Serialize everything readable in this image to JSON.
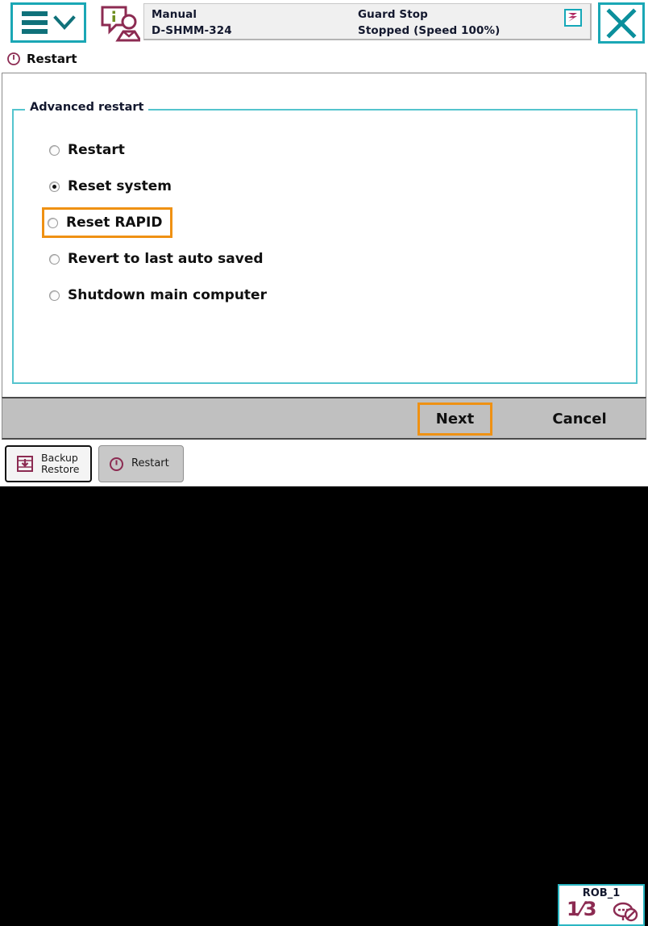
{
  "window": {
    "title": "Restart",
    "title_icon": "power-restart-icon"
  },
  "header": {
    "menu_button": {
      "icon": "hamburger-menu-icon",
      "chevron": "chevron-down-icon"
    },
    "user_icon": "info-user-icon",
    "close_label": "close-icon",
    "status": {
      "operating_mode": "Manual",
      "system_id": "D-SHMM-324",
      "safety_state": "Guard Stop",
      "run_state": "Stopped (Speed 100%)",
      "rapid_icon": "rapid-execution-icon"
    }
  },
  "main": {
    "group_legend": "Advanced restart",
    "options": [
      {
        "label": "Restart",
        "selected": false,
        "focused": false
      },
      {
        "label": "Reset system",
        "selected": true,
        "focused": false
      },
      {
        "label": "Reset RAPID",
        "selected": false,
        "focused": true
      },
      {
        "label": "Revert to last auto saved",
        "selected": false,
        "focused": false
      },
      {
        "label": "Shutdown main computer",
        "selected": false,
        "focused": false
      }
    ]
  },
  "actions": {
    "next_label": "Next",
    "cancel_label": "Cancel"
  },
  "taskbar": {
    "items": [
      {
        "label_line1": "Backup",
        "label_line2": "Restore",
        "icon": "backup-restore-icon",
        "active": true
      },
      {
        "label_line1": "Restart",
        "label_line2": "",
        "icon": "power-restart-icon",
        "active": false
      }
    ],
    "robot": {
      "name": "ROB_1",
      "numerator": "1",
      "denominator": "3",
      "icon": "motors-off-icon"
    }
  },
  "colors": {
    "accent_teal": "#1aa7b5",
    "focus_orange": "#ef9113",
    "maroon": "#8c2b52",
    "navy_text": "#13182e",
    "footer_gray": "#c0c0c0",
    "fieldset_border": "#54c4ce"
  }
}
